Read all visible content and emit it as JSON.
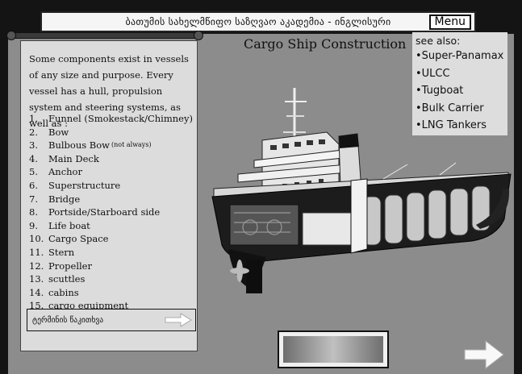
{
  "header": {
    "title": "ბათუმის სახელმწიფო საზღვაო აკადემია - ინგლისური",
    "menu_label": "Menu"
  },
  "main": {
    "title": "Cargo Ship Construction"
  },
  "left_panel": {
    "intro": "Some components exist in vessels of any size and purpose. Every vessel has a hull, propulsion system and steering systems, as well as :",
    "components": [
      {
        "num": "1.",
        "label": "Funnel (Smokestack/Chimney)",
        "note": ""
      },
      {
        "num": "2.",
        "label": "Bow",
        "note": ""
      },
      {
        "num": "3.",
        "label": "Bulbous Bow",
        "note": "(not always)"
      },
      {
        "num": "4.",
        "label": "Main Deck",
        "note": ""
      },
      {
        "num": "5.",
        "label": "Anchor",
        "note": ""
      },
      {
        "num": "6.",
        "label": "Superstructure",
        "note": ""
      },
      {
        "num": "7.",
        "label": "Bridge",
        "note": ""
      },
      {
        "num": "8.",
        "label": "Portside/Starboard side",
        "note": ""
      },
      {
        "num": "9.",
        "label": "Life boat",
        "note": ""
      },
      {
        "num": "10.",
        "label": "Cargo Space",
        "note": ""
      },
      {
        "num": "11.",
        "label": "Stern",
        "note": ""
      },
      {
        "num": "12.",
        "label": "Propeller",
        "note": ""
      },
      {
        "num": "13.",
        "label": "scuttles",
        "note": ""
      },
      {
        "num": "14.",
        "label": "cabins",
        "note": ""
      },
      {
        "num": "15.",
        "label": "cargo equipment",
        "note": ""
      }
    ],
    "nav_label": "ტერმინის წაკითხვა"
  },
  "see_also": {
    "title": "see also:",
    "links": [
      "•Super-Panamax",
      "•ULCC",
      "•Tugboat",
      "•Bulk Carrier",
      "•LNG Tankers"
    ]
  },
  "icons": {
    "panel_arrow": "right-arrow-icon",
    "next_arrow": "next-arrow-icon",
    "ship": "cargo-ship-cutaway-illustration"
  },
  "colors": {
    "background": "#8c8c8c",
    "frame": "#141414",
    "panel": "#dcdcdc"
  }
}
